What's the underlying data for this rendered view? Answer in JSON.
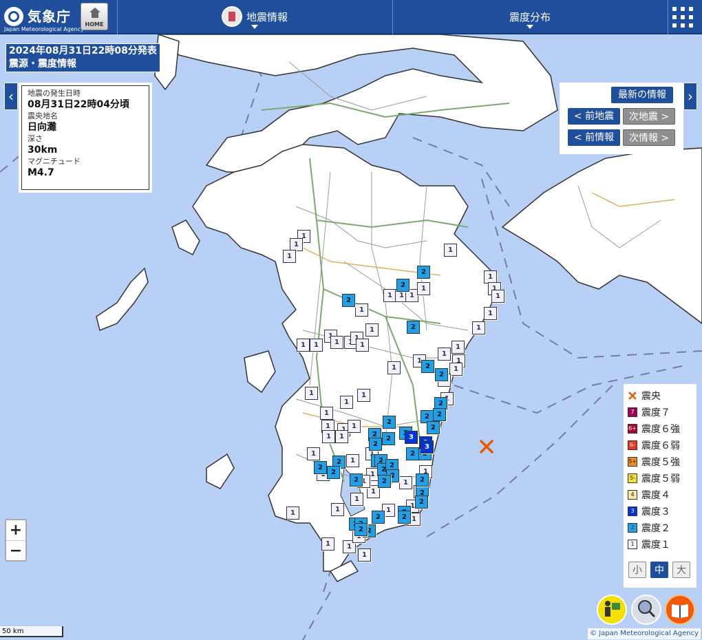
{
  "header": {
    "logo_jp": "気象庁",
    "logo_en": "Japan Meteorological Agency",
    "home_label": "HOME",
    "menu_quake_info": "地震情報",
    "menu_intensity": "震度分布"
  },
  "title": {
    "line1": "2024年08月31日22時08分発表",
    "line2": "震源・震度情報"
  },
  "info": {
    "time_label": "地震の発生日時",
    "time_value": "08月31日22時04分頃",
    "place_label": "震央地名",
    "place_value": "日向灘",
    "depth_label": "深さ",
    "depth_value": "30km",
    "mag_label": "マグニチュード",
    "mag_value": "M4.7"
  },
  "quake_nav": {
    "latest": "最新の情報",
    "prev_quake": "< 前地震",
    "next_quake": "次地震 >",
    "prev_info": "< 前情報",
    "next_info": "次情報 >"
  },
  "legend": {
    "epicenter": "震央",
    "items": [
      {
        "badge": "7",
        "label": "震度７",
        "color": "#a0005a"
      },
      {
        "badge": "6+",
        "label": "震度６強",
        "color": "#b4002c"
      },
      {
        "badge": "6-",
        "label": "震度６弱",
        "color": "#e8381c"
      },
      {
        "badge": "5+",
        "label": "震度５強",
        "color": "#f08c1c"
      },
      {
        "badge": "5-",
        "label": "震度５弱",
        "color": "#f8e028"
      },
      {
        "badge": "4",
        "label": "震度４",
        "color": "#f8e8a8"
      },
      {
        "badge": "3",
        "label": "震度３",
        "color": "#0036d8"
      },
      {
        "badge": "2",
        "label": "震度２",
        "color": "#1fa0e8"
      },
      {
        "badge": "1",
        "label": "震度１",
        "color": "#f2f2ff"
      }
    ],
    "size_small": "小",
    "size_medium": "中",
    "size_large": "大"
  },
  "zoom": {
    "in": "+",
    "out": "−"
  },
  "scale": "50 km",
  "copyright": "© Japan Meteorological Agency",
  "colors": {
    "header": "#1f4f9c",
    "sea": "#b8d0f5",
    "land": "#ffffff",
    "epicenter": "#e85a00"
  },
  "station_counts": {
    "intensity_3": 3,
    "intensity_2": 38,
    "intensity_1": 60
  }
}
